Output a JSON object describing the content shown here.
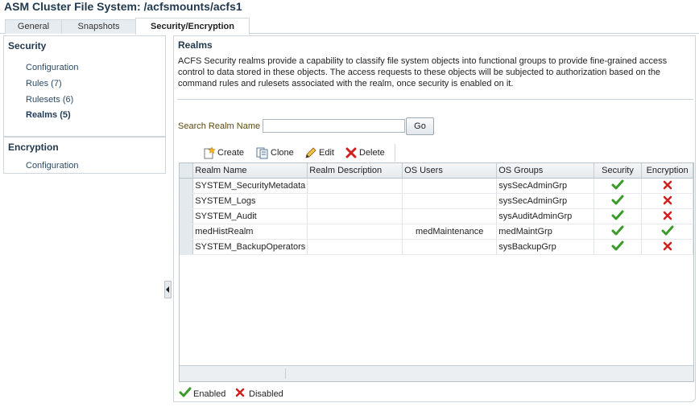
{
  "page": {
    "title": "ASM Cluster File System: /acfsmounts/acfs1"
  },
  "tabs": [
    {
      "label": "General",
      "active": false
    },
    {
      "label": "Snapshots",
      "active": false
    },
    {
      "label": "Security/Encryption",
      "active": true
    }
  ],
  "sidebar": {
    "security": {
      "title": "Security",
      "items": [
        {
          "label": "Configuration",
          "selected": false
        },
        {
          "label": "Rules (7)",
          "selected": false
        },
        {
          "label": "Rulesets (6)",
          "selected": false
        },
        {
          "label": "Realms (5)",
          "selected": true
        }
      ]
    },
    "encryption": {
      "title": "Encryption",
      "items": [
        {
          "label": "Configuration",
          "selected": false
        }
      ]
    }
  },
  "main": {
    "title": "Realms",
    "description": "ACFS Security realms provide a capability to classify file system objects into functional groups to provide fine-grained access control to data stored in these objects. The access requests to these objects will be subjected to authorization based on the command rules and rulesets associated with the realm, once security is enabled on it.",
    "search": {
      "label": "Search Realm Name",
      "value": "",
      "placeholder": "",
      "go_label": "Go"
    },
    "toolbar": {
      "create": "Create",
      "clone": "Clone",
      "edit": "Edit",
      "delete": "Delete"
    },
    "table": {
      "columns": [
        "Realm Name",
        "Realm Description",
        "OS Users",
        "OS Groups",
        "Security",
        "Encryption"
      ],
      "rows": [
        {
          "name": "SYSTEM_SecurityMetadata",
          "description": "",
          "os_users": "",
          "os_groups": "sysSecAdminGrp",
          "security": "enabled",
          "encryption": "disabled"
        },
        {
          "name": "SYSTEM_Logs",
          "description": "",
          "os_users": "",
          "os_groups": "sysSecAdminGrp",
          "security": "enabled",
          "encryption": "disabled"
        },
        {
          "name": "SYSTEM_Audit",
          "description": "",
          "os_users": "",
          "os_groups": "sysAuditAdminGrp",
          "security": "enabled",
          "encryption": "disabled"
        },
        {
          "name": "medHistRealm",
          "description": "",
          "os_users": "medMaintenance",
          "os_groups": "medMaintGrp",
          "security": "enabled",
          "encryption": "enabled"
        },
        {
          "name": "SYSTEM_BackupOperators",
          "description": "",
          "os_users": "",
          "os_groups": "sysBackupGrp",
          "security": "enabled",
          "encryption": "disabled"
        }
      ]
    },
    "legend": {
      "enabled": "Enabled",
      "disabled": "Disabled"
    }
  },
  "colors": {
    "enabled_check": "#3a9b2a",
    "disabled_x": "#d11f1f",
    "header_text": "#223a4f"
  }
}
